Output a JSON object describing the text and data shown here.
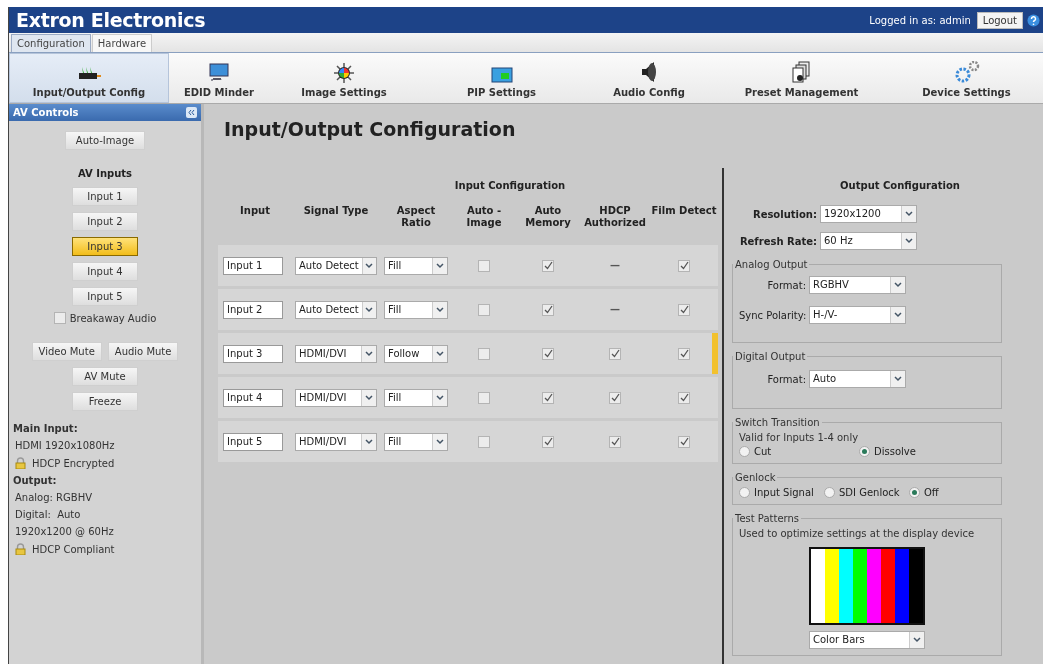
{
  "header": {
    "title": "Extron Electronics",
    "login_text": "Logged in as: admin",
    "logout": "Logout"
  },
  "top_tabs": [
    {
      "label": "Configuration",
      "selected": true
    },
    {
      "label": "Hardware",
      "selected": false
    }
  ],
  "nav": [
    {
      "label": "Input/Output Config",
      "selected": true
    },
    {
      "label": "EDID Minder",
      "selected": false
    },
    {
      "label": "Image Settings",
      "selected": false
    },
    {
      "label": "PIP Settings",
      "selected": false
    },
    {
      "label": "Audio Config",
      "selected": false
    },
    {
      "label": "Preset Management",
      "selected": false
    },
    {
      "label": "Device Settings",
      "selected": false
    }
  ],
  "sidebar": {
    "title": "AV Controls",
    "auto_image": "Auto-Image",
    "inputs_heading": "AV Inputs",
    "inputs": [
      {
        "label": "Input 1",
        "selected": false
      },
      {
        "label": "Input 2",
        "selected": false
      },
      {
        "label": "Input 3",
        "selected": true
      },
      {
        "label": "Input 4",
        "selected": false
      },
      {
        "label": "Input 5",
        "selected": false
      }
    ],
    "breakaway": {
      "label": "Breakaway Audio",
      "checked": false
    },
    "mute_buttons": [
      "Video Mute",
      "Audio Mute"
    ],
    "av_mute": "AV Mute",
    "freeze": "Freeze",
    "status": [
      {
        "kind": "heading",
        "text": "Main Input:"
      },
      {
        "kind": "text",
        "text": "HDMI 1920x1080Hz"
      },
      {
        "kind": "lock",
        "text": "HDCP Encrypted"
      },
      {
        "kind": "heading",
        "text": "Output:"
      },
      {
        "kind": "text",
        "text": "Analog: RGBHV"
      },
      {
        "kind": "text",
        "text": "Digital:  Auto"
      },
      {
        "kind": "text",
        "text": "1920x1200 @ 60Hz"
      },
      {
        "kind": "lock",
        "text": "HDCP Compliant"
      }
    ]
  },
  "page_title": "Input/Output Configuration",
  "input_config": {
    "title": "Input Configuration",
    "columns": [
      "Input",
      "Signal Type",
      "Aspect Ratio",
      "Auto - Image",
      "Auto Memory",
      "HDCP Authorized",
      "Film Detect"
    ],
    "rows": [
      {
        "name": "Input 1",
        "signal_type": "Auto Detect",
        "aspect_ratio": "Fill",
        "auto_image": false,
        "auto_memory": true,
        "hdcp_authorized": {
          "kind": "dash",
          "text": "—"
        },
        "film_detect": true,
        "selected": false
      },
      {
        "name": "Input 2",
        "signal_type": "Auto Detect",
        "aspect_ratio": "Fill",
        "auto_image": false,
        "auto_memory": true,
        "hdcp_authorized": {
          "kind": "dash",
          "text": "—"
        },
        "film_detect": true,
        "selected": false
      },
      {
        "name": "Input 3",
        "signal_type": "HDMI/DVI",
        "aspect_ratio": "Follow",
        "auto_image": false,
        "auto_memory": true,
        "hdcp_authorized": {
          "kind": "checkbox",
          "checked": true
        },
        "film_detect": true,
        "selected": true
      },
      {
        "name": "Input 4",
        "signal_type": "HDMI/DVI",
        "aspect_ratio": "Fill",
        "auto_image": false,
        "auto_memory": true,
        "hdcp_authorized": {
          "kind": "checkbox",
          "checked": true
        },
        "film_detect": true,
        "selected": false
      },
      {
        "name": "Input 5",
        "signal_type": "HDMI/DVI",
        "aspect_ratio": "Fill",
        "auto_image": false,
        "auto_memory": true,
        "hdcp_authorized": {
          "kind": "checkbox",
          "checked": true
        },
        "film_detect": true,
        "selected": false
      }
    ]
  },
  "output_config": {
    "title": "Output Configuration",
    "main_fields": [
      {
        "label": "Resolution:",
        "value": "1920x1200"
      },
      {
        "label": "Refresh Rate:",
        "value": "60 Hz"
      }
    ],
    "analog_output": {
      "legend": "Analog Output",
      "fields": [
        {
          "label": "Format:",
          "value": "RGBHV"
        },
        {
          "label": "Sync Polarity:",
          "value": "H-/V-"
        }
      ]
    },
    "digital_output": {
      "legend": "Digital Output",
      "fields": [
        {
          "label": "Format:",
          "value": "Auto"
        }
      ]
    },
    "switch_transition": {
      "legend": "Switch Transition",
      "note": "Valid for Inputs 1-4 only",
      "options": [
        {
          "label": "Cut",
          "selected": false
        },
        {
          "label": "Dissolve",
          "selected": true
        }
      ]
    },
    "genlock": {
      "legend": "Genlock",
      "options": [
        {
          "label": "Input Signal",
          "selected": false
        },
        {
          "label": "SDI Genlock",
          "selected": false
        },
        {
          "label": "Off",
          "selected": true
        }
      ]
    },
    "test_patterns": {
      "legend": "Test Patterns",
      "note": "Used to optimize settings at the display device",
      "pattern": "Color Bars"
    }
  }
}
